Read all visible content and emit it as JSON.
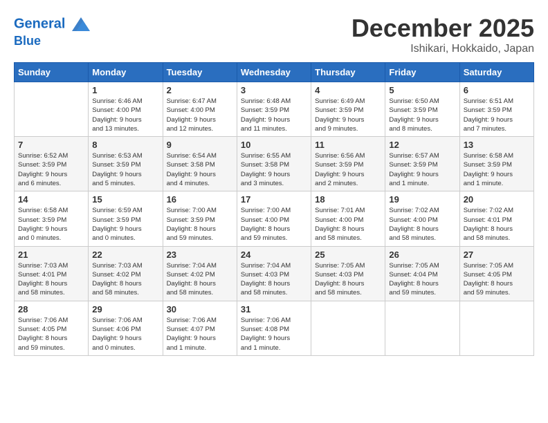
{
  "header": {
    "logo_line1": "General",
    "logo_line2": "Blue",
    "month": "December 2025",
    "location": "Ishikari, Hokkaido, Japan"
  },
  "days_of_week": [
    "Sunday",
    "Monday",
    "Tuesday",
    "Wednesday",
    "Thursday",
    "Friday",
    "Saturday"
  ],
  "weeks": [
    [
      {
        "day": "",
        "info": ""
      },
      {
        "day": "1",
        "info": "Sunrise: 6:46 AM\nSunset: 4:00 PM\nDaylight: 9 hours\nand 13 minutes."
      },
      {
        "day": "2",
        "info": "Sunrise: 6:47 AM\nSunset: 4:00 PM\nDaylight: 9 hours\nand 12 minutes."
      },
      {
        "day": "3",
        "info": "Sunrise: 6:48 AM\nSunset: 3:59 PM\nDaylight: 9 hours\nand 11 minutes."
      },
      {
        "day": "4",
        "info": "Sunrise: 6:49 AM\nSunset: 3:59 PM\nDaylight: 9 hours\nand 9 minutes."
      },
      {
        "day": "5",
        "info": "Sunrise: 6:50 AM\nSunset: 3:59 PM\nDaylight: 9 hours\nand 8 minutes."
      },
      {
        "day": "6",
        "info": "Sunrise: 6:51 AM\nSunset: 3:59 PM\nDaylight: 9 hours\nand 7 minutes."
      }
    ],
    [
      {
        "day": "7",
        "info": "Sunrise: 6:52 AM\nSunset: 3:59 PM\nDaylight: 9 hours\nand 6 minutes."
      },
      {
        "day": "8",
        "info": "Sunrise: 6:53 AM\nSunset: 3:59 PM\nDaylight: 9 hours\nand 5 minutes."
      },
      {
        "day": "9",
        "info": "Sunrise: 6:54 AM\nSunset: 3:58 PM\nDaylight: 9 hours\nand 4 minutes."
      },
      {
        "day": "10",
        "info": "Sunrise: 6:55 AM\nSunset: 3:58 PM\nDaylight: 9 hours\nand 3 minutes."
      },
      {
        "day": "11",
        "info": "Sunrise: 6:56 AM\nSunset: 3:59 PM\nDaylight: 9 hours\nand 2 minutes."
      },
      {
        "day": "12",
        "info": "Sunrise: 6:57 AM\nSunset: 3:59 PM\nDaylight: 9 hours\nand 1 minute."
      },
      {
        "day": "13",
        "info": "Sunrise: 6:58 AM\nSunset: 3:59 PM\nDaylight: 9 hours\nand 1 minute."
      }
    ],
    [
      {
        "day": "14",
        "info": "Sunrise: 6:58 AM\nSunset: 3:59 PM\nDaylight: 9 hours\nand 0 minutes."
      },
      {
        "day": "15",
        "info": "Sunrise: 6:59 AM\nSunset: 3:59 PM\nDaylight: 9 hours\nand 0 minutes."
      },
      {
        "day": "16",
        "info": "Sunrise: 7:00 AM\nSunset: 3:59 PM\nDaylight: 8 hours\nand 59 minutes."
      },
      {
        "day": "17",
        "info": "Sunrise: 7:00 AM\nSunset: 4:00 PM\nDaylight: 8 hours\nand 59 minutes."
      },
      {
        "day": "18",
        "info": "Sunrise: 7:01 AM\nSunset: 4:00 PM\nDaylight: 8 hours\nand 58 minutes."
      },
      {
        "day": "19",
        "info": "Sunrise: 7:02 AM\nSunset: 4:00 PM\nDaylight: 8 hours\nand 58 minutes."
      },
      {
        "day": "20",
        "info": "Sunrise: 7:02 AM\nSunset: 4:01 PM\nDaylight: 8 hours\nand 58 minutes."
      }
    ],
    [
      {
        "day": "21",
        "info": "Sunrise: 7:03 AM\nSunset: 4:01 PM\nDaylight: 8 hours\nand 58 minutes."
      },
      {
        "day": "22",
        "info": "Sunrise: 7:03 AM\nSunset: 4:02 PM\nDaylight: 8 hours\nand 58 minutes."
      },
      {
        "day": "23",
        "info": "Sunrise: 7:04 AM\nSunset: 4:02 PM\nDaylight: 8 hours\nand 58 minutes."
      },
      {
        "day": "24",
        "info": "Sunrise: 7:04 AM\nSunset: 4:03 PM\nDaylight: 8 hours\nand 58 minutes."
      },
      {
        "day": "25",
        "info": "Sunrise: 7:05 AM\nSunset: 4:03 PM\nDaylight: 8 hours\nand 58 minutes."
      },
      {
        "day": "26",
        "info": "Sunrise: 7:05 AM\nSunset: 4:04 PM\nDaylight: 8 hours\nand 59 minutes."
      },
      {
        "day": "27",
        "info": "Sunrise: 7:05 AM\nSunset: 4:05 PM\nDaylight: 8 hours\nand 59 minutes."
      }
    ],
    [
      {
        "day": "28",
        "info": "Sunrise: 7:06 AM\nSunset: 4:05 PM\nDaylight: 8 hours\nand 59 minutes."
      },
      {
        "day": "29",
        "info": "Sunrise: 7:06 AM\nSunset: 4:06 PM\nDaylight: 9 hours\nand 0 minutes."
      },
      {
        "day": "30",
        "info": "Sunrise: 7:06 AM\nSunset: 4:07 PM\nDaylight: 9 hours\nand 1 minute."
      },
      {
        "day": "31",
        "info": "Sunrise: 7:06 AM\nSunset: 4:08 PM\nDaylight: 9 hours\nand 1 minute."
      },
      {
        "day": "",
        "info": ""
      },
      {
        "day": "",
        "info": ""
      },
      {
        "day": "",
        "info": ""
      }
    ]
  ]
}
